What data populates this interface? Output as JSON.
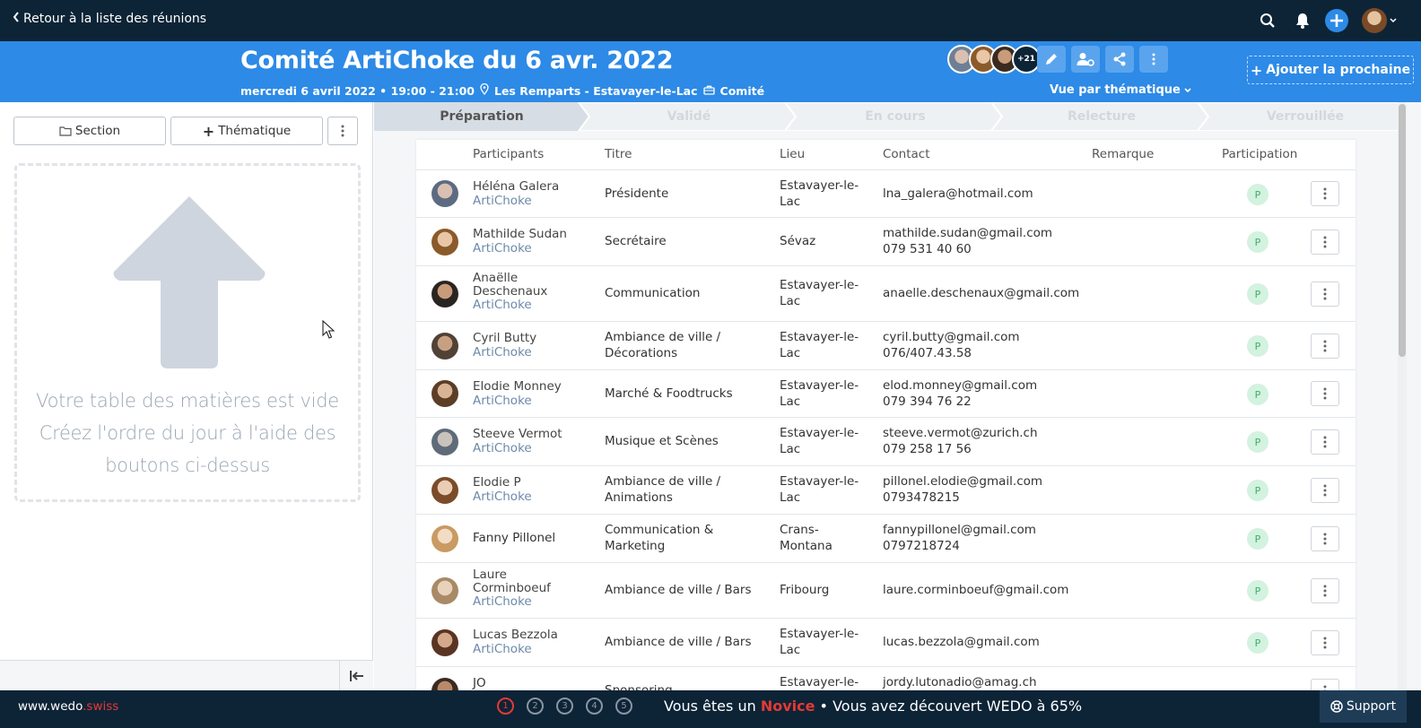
{
  "topnav": {
    "back_label": "Retour à la liste des réunions"
  },
  "meeting": {
    "title": "Comité ArtiChoke du 6 avr. 2022",
    "date_time": "mercredi 6 avril 2022 • 19:00 - 21:00",
    "location": "Les Remparts - Estavayer-le-Lac",
    "type": "Comité",
    "extra_participants": "+21",
    "view_label": "Vue par thématique",
    "add_next_label": "Ajouter la prochaine"
  },
  "sidebar": {
    "section_button": "Section",
    "theme_button": "Thématique",
    "empty_line1": "Votre table des matières est vide",
    "empty_line2": "Créez l'ordre du jour à l'aide des",
    "empty_line3": "boutons ci-dessus"
  },
  "steps": [
    "Préparation",
    "Validé",
    "En cours",
    "Relecture",
    "Verrouillée"
  ],
  "table": {
    "headers": {
      "participants": "Participants",
      "title": "Titre",
      "place": "Lieu",
      "contact": "Contact",
      "remark": "Remarque",
      "participation": "Participation"
    },
    "rows": [
      {
        "name": "Héléna Galera",
        "org": "ArtiChoke",
        "title1": "Présidente",
        "title2": "",
        "place1": "Estavayer-le-",
        "place2": "Lac",
        "contact1": "lna_galera@hotmail.com",
        "contact2": "",
        "status": "P"
      },
      {
        "name": "Mathilde Sudan",
        "org": "ArtiChoke",
        "title1": "Secrétaire",
        "title2": "",
        "place1": "Sévaz",
        "place2": "",
        "contact1": "mathilde.sudan@gmail.com",
        "contact2": "079 531 40 60",
        "status": "P"
      },
      {
        "name": "Anaëlle",
        "name2": "Deschenaux",
        "org": "ArtiChoke",
        "title1": "Communication",
        "title2": "",
        "place1": "Estavayer-le-",
        "place2": "Lac",
        "contact1": "anaelle.deschenaux@gmail.com",
        "contact2": "",
        "status": "P"
      },
      {
        "name": "Cyril Butty",
        "org": "ArtiChoke",
        "title1": "Ambiance de ville /",
        "title2": "Décorations",
        "place1": "Estavayer-le-",
        "place2": "Lac",
        "contact1": "cyril.butty@gmail.com",
        "contact2": "076/407.43.58",
        "status": "P"
      },
      {
        "name": "Elodie Monney",
        "org": "ArtiChoke",
        "title1": "Marché & Foodtrucks",
        "title2": "",
        "place1": "Estavayer-le-",
        "place2": "Lac",
        "contact1": "elod.monney@gmail.com",
        "contact2": "079 394 76 22",
        "status": "P"
      },
      {
        "name": "Steeve Vermot",
        "org": "ArtiChoke",
        "title1": "Musique et Scènes",
        "title2": "",
        "place1": "Estavayer-le-",
        "place2": "Lac",
        "contact1": "steeve.vermot@zurich.ch",
        "contact2": "079 258 17 56",
        "status": "P"
      },
      {
        "name": "Elodie P",
        "org": "ArtiChoke",
        "title1": "Ambiance de ville /",
        "title2": "Animations",
        "place1": "Estavayer-le-",
        "place2": "Lac",
        "contact1": "pillonel.elodie@gmail.com",
        "contact2": "0793478215",
        "status": "P"
      },
      {
        "name": "Fanny Pillonel",
        "org": "",
        "title1": "Communication &",
        "title2": "Marketing",
        "place1": "Crans-",
        "place2": "Montana",
        "contact1": "fannypillonel@gmail.com",
        "contact2": "0797218724",
        "status": "P"
      },
      {
        "name": "Laure",
        "name2": "Corminboeuf",
        "org": "ArtiChoke",
        "title1": "Ambiance de ville / Bars",
        "title2": "",
        "place1": "Fribourg",
        "place2": "",
        "contact1": "laure.corminboeuf@gmail.com",
        "contact2": "",
        "status": "P"
      },
      {
        "name": "Lucas Bezzola",
        "org": "ArtiChoke",
        "title1": "Ambiance de ville / Bars",
        "title2": "",
        "place1": "Estavayer-le-",
        "place2": "Lac",
        "contact1": "lucas.bezzola@gmail.com",
        "contact2": "",
        "status": "P"
      },
      {
        "name": "JO",
        "org": "",
        "title1": "Sponsoring",
        "title2": "",
        "place1": "Estavayer-le-",
        "place2": "",
        "contact1": "jordy.lutonadio@amag.ch",
        "contact2": "",
        "status": ""
      }
    ]
  },
  "footer": {
    "site_main": "www.wedo",
    "site_tld": ".swiss",
    "levels": [
      "1",
      "2",
      "3",
      "4",
      "5"
    ],
    "msg_prefix": "Vous êtes un",
    "msg_level": "Novice",
    "msg_suffix": "• Vous avez découvert WEDO à 65%",
    "support_label": "Support"
  }
}
